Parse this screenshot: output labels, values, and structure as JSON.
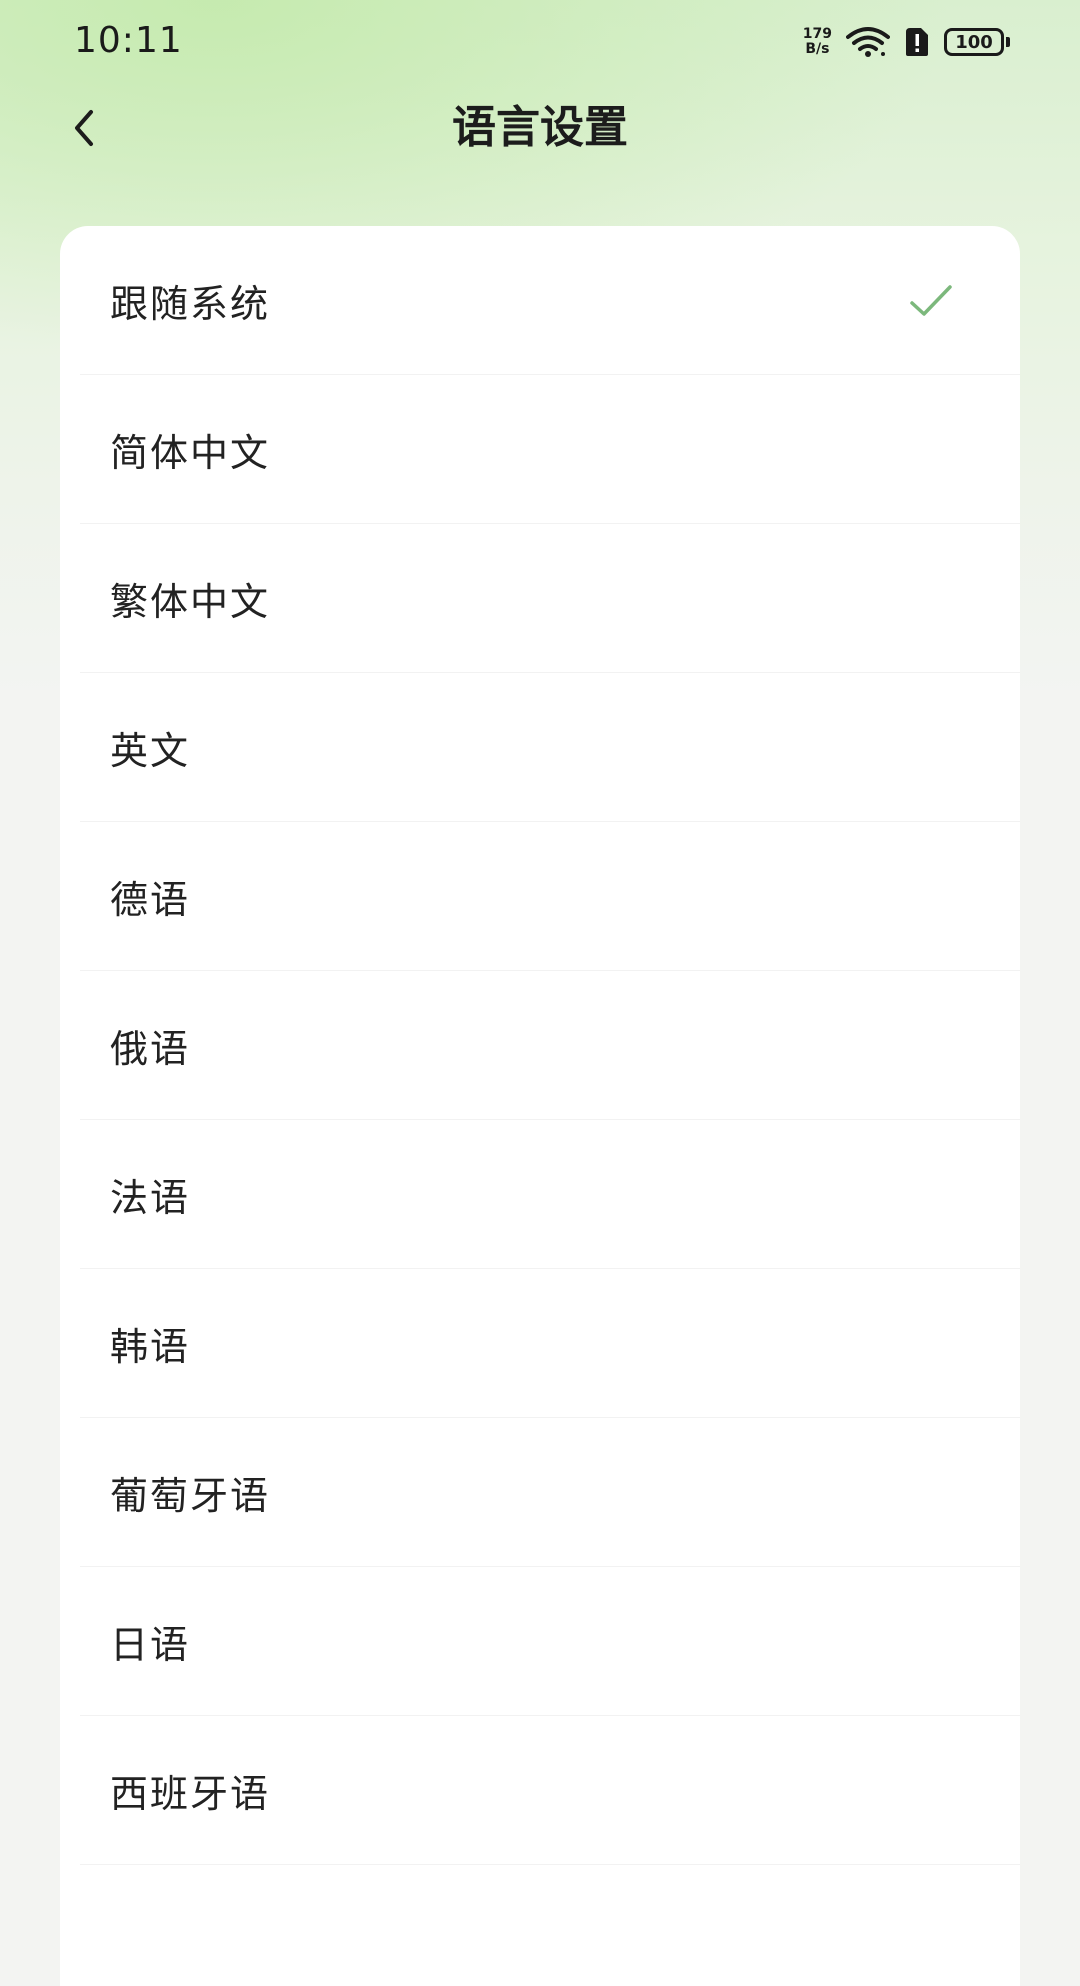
{
  "status_bar": {
    "time": "10:11",
    "net_speed_value": "179",
    "net_speed_unit": "B/s",
    "battery_level": "100",
    "icons": [
      "wifi-icon",
      "sim-alert-icon",
      "battery-icon"
    ]
  },
  "header": {
    "title": "语言设置",
    "back_icon": "chevron-left-icon"
  },
  "languages": {
    "selected_index": 0,
    "items": [
      {
        "label": "跟随系统"
      },
      {
        "label": "简体中文"
      },
      {
        "label": "繁体中文"
      },
      {
        "label": "英文"
      },
      {
        "label": "德语"
      },
      {
        "label": "俄语"
      },
      {
        "label": "法语"
      },
      {
        "label": "韩语"
      },
      {
        "label": "葡萄牙语"
      },
      {
        "label": "日语"
      },
      {
        "label": "西班牙语"
      }
    ]
  },
  "colors": {
    "accent_check": "#7cb87c",
    "text_primary": "#222222",
    "gradient_top": "#d9efcf"
  }
}
